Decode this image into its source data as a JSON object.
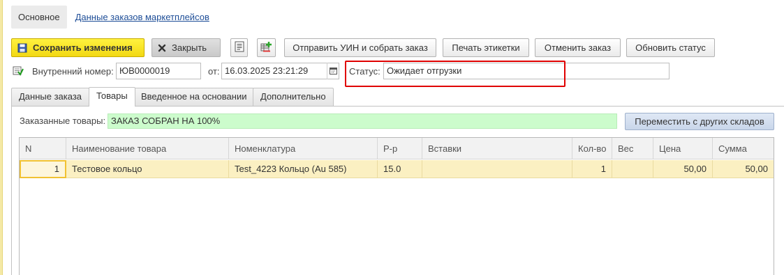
{
  "nav": {
    "active_tab": "Основное",
    "link": "Данные заказов маркетплейсов"
  },
  "toolbar": {
    "save_label": "Сохранить изменения",
    "close_label": "Закрыть",
    "send_label": "Отправить УИН и собрать заказ",
    "print_label": "Печать этикетки",
    "cancel_label": "Отменить заказ",
    "refresh_label": "Обновить статус",
    "icon_structure": "document-list-icon",
    "icon_add": "add-row-icon"
  },
  "fields": {
    "internal_number_label": "Внутренний номер:",
    "internal_number_value": "ЮВ0000019",
    "from_label": "от:",
    "date_value": "16.03.2025 23:21:29",
    "status_label": "Статус:",
    "status_value": "Ожидает отгрузки"
  },
  "tabs": [
    {
      "label": "Данные заказа",
      "active": false
    },
    {
      "label": "Товары",
      "active": true
    },
    {
      "label": "Введенное на основании",
      "active": false
    },
    {
      "label": "Дополнительно",
      "active": false
    }
  ],
  "goods": {
    "label": "Заказанные товары:",
    "status": "ЗАКАЗ СОБРАН НА 100%",
    "move_button": "Переместить с других складов"
  },
  "table": {
    "headers": [
      "N",
      "Наименование товара",
      "Номенклатура",
      "Р-р",
      "Вставки",
      "Кол-во",
      "Вес",
      "Цена",
      "Сумма"
    ],
    "rows": [
      {
        "n": "1",
        "name": "Тестовое кольцо",
        "nomenclature": "Test_4223 Кольцо (Au 585)",
        "size": "15.0",
        "inserts": "",
        "qty": "1",
        "weight": "",
        "price": "50,00",
        "sum": "50,00"
      }
    ]
  },
  "colors": {
    "save_button": "#f5dd1c",
    "status_highlight_border": "#e00000",
    "goods_status_bg": "#ccfccc",
    "selected_row_bg": "#fbf0c2",
    "link": "#1d4d97"
  }
}
